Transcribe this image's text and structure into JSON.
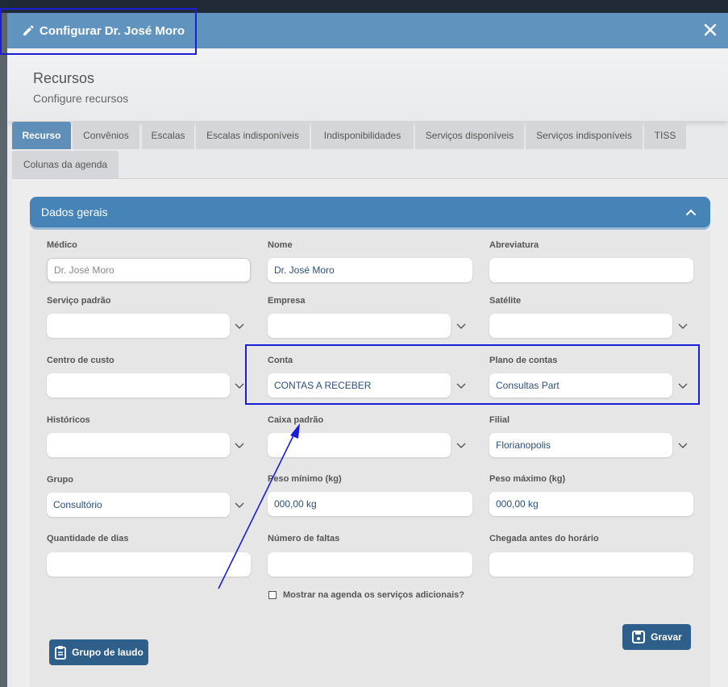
{
  "modal": {
    "title": "Configurar Dr. José Moro"
  },
  "header": {
    "title": "Recursos",
    "subtitle": "Configure recursos"
  },
  "tabs": [
    {
      "label": "Recurso"
    },
    {
      "label": "Convênios"
    },
    {
      "label": "Escalas"
    },
    {
      "label": "Escalas indisponíveis"
    },
    {
      "label": "Indisponibilidades"
    },
    {
      "label": "Serviços disponíveis"
    },
    {
      "label": "Serviços indisponíveis"
    },
    {
      "label": "TISS"
    },
    {
      "label": "Colunas da agenda"
    }
  ],
  "panel": {
    "title": "Dados gerais"
  },
  "fields": {
    "medico": {
      "label": "Médico",
      "value": "Dr. José Moro"
    },
    "nome": {
      "label": "Nome",
      "value": "Dr. José Moro"
    },
    "abreviatura": {
      "label": "Abreviatura",
      "value": ""
    },
    "servico_padrao": {
      "label": "Serviço padrão",
      "value": ""
    },
    "empresa": {
      "label": "Empresa",
      "value": ""
    },
    "satelite": {
      "label": "Satélite",
      "value": ""
    },
    "centro_custo": {
      "label": "Centro de custo",
      "value": ""
    },
    "conta": {
      "label": "Conta",
      "value": "CONTAS A RECEBER"
    },
    "plano_contas": {
      "label": "Plano de contas",
      "value": "Consultas Part"
    },
    "historicos": {
      "label": "Históricos",
      "value": ""
    },
    "caixa_padrao": {
      "label": "Caixa padrão",
      "value": ""
    },
    "filial": {
      "label": "Filial",
      "value": "Florianopolis"
    },
    "grupo": {
      "label": "Grupo",
      "value": "Consultório"
    },
    "peso_min": {
      "label": "Peso mínimo (kg)",
      "value": "000,00 kg"
    },
    "peso_max": {
      "label": "Peso máximo (kg)",
      "value": "000,00 kg"
    },
    "qtd_dias": {
      "label": "Quantidade de dias",
      "value": ""
    },
    "num_faltas": {
      "label": "Número de faltas",
      "value": ""
    },
    "chegada": {
      "label": "Chegada antes do horário",
      "value": ""
    }
  },
  "checkbox": {
    "label": "Mostrar na agenda os serviços adicionais?"
  },
  "buttons": {
    "save": "Gravar",
    "group": "Grupo de laudo"
  },
  "colors": {
    "header": "#6193bf",
    "panel": "#4683b6",
    "button": "#2d5f8a",
    "annotation": "#1a1fd6"
  }
}
